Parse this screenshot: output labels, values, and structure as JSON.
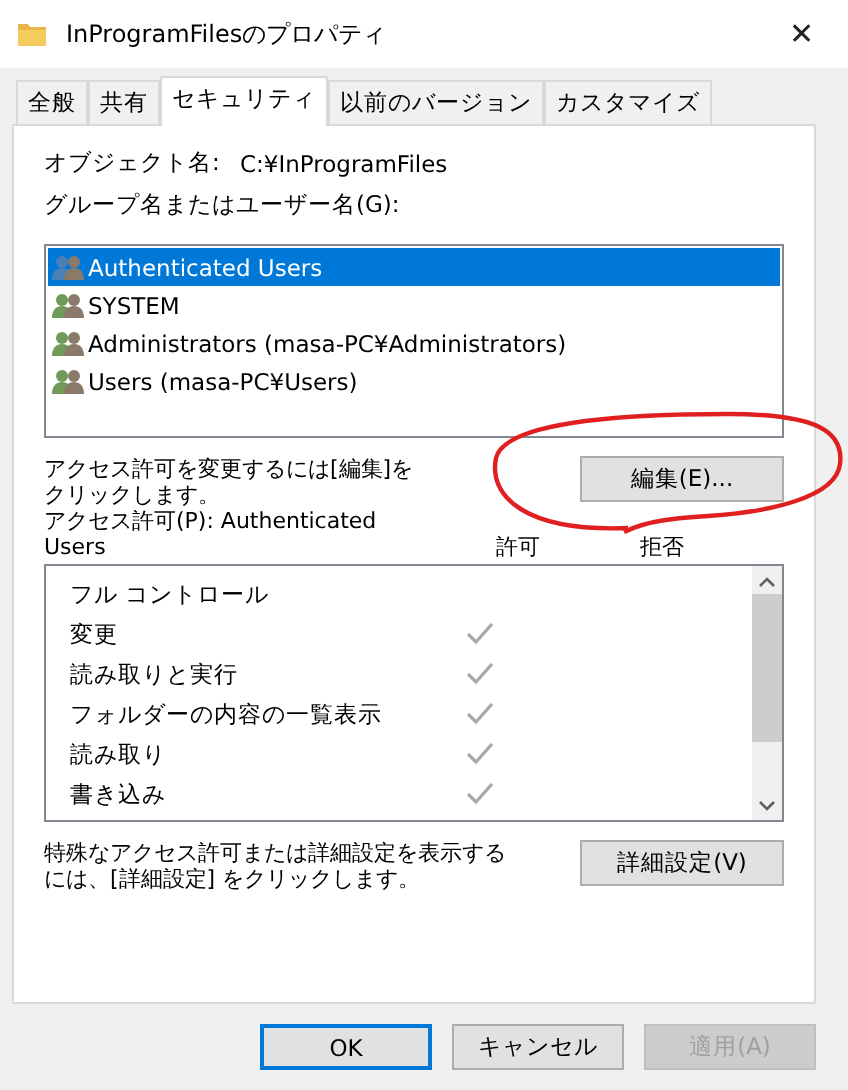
{
  "window": {
    "title": "InProgramFilesのプロパティ",
    "close": "✕"
  },
  "tabs": [
    {
      "label": "全般",
      "selected": false
    },
    {
      "label": "共有",
      "selected": false
    },
    {
      "label": "セキュリティ",
      "selected": true
    },
    {
      "label": "以前のバージョン",
      "selected": false
    },
    {
      "label": "カスタマイズ",
      "selected": false
    }
  ],
  "object_name": {
    "label": "オブジェクト名:",
    "value": "C:¥InProgramFiles"
  },
  "group_label": "グループ名またはユーザー名(G):",
  "users": [
    {
      "name": "Authenticated Users",
      "selected": true
    },
    {
      "name": "SYSTEM",
      "selected": false
    },
    {
      "name": "Administrators (masa-PC¥Administrators)",
      "selected": false
    },
    {
      "name": "Users (masa-PC¥Users)",
      "selected": false
    }
  ],
  "edit_hint": [
    "アクセス許可を変更するには[編集]を",
    "クリックします。"
  ],
  "edit_button": "編集(E)...",
  "permissions_label": [
    "アクセス許可(P): Authenticated",
    "Users"
  ],
  "columns": {
    "allow": "許可",
    "deny": "拒否"
  },
  "permissions": [
    {
      "name": "フル コントロール",
      "allow": false,
      "deny": false
    },
    {
      "name": "変更",
      "allow": true,
      "deny": false
    },
    {
      "name": "読み取りと実行",
      "allow": true,
      "deny": false
    },
    {
      "name": "フォルダーの内容の一覧表示",
      "allow": true,
      "deny": false
    },
    {
      "name": "読み取り",
      "allow": true,
      "deny": false
    },
    {
      "name": "書き込み",
      "allow": true,
      "deny": false
    }
  ],
  "advanced_hint": [
    "特殊なアクセス許可または詳細設定を表示する",
    "には、[詳細設定] をクリックします。"
  ],
  "advanced_button": "詳細設定(V)",
  "buttons": [
    {
      "label": "OK",
      "kind": "default",
      "disabled": false
    },
    {
      "label": "キャンセル",
      "kind": "normal",
      "disabled": false
    },
    {
      "label": "適用(A)",
      "kind": "normal",
      "disabled": true
    }
  ],
  "annotations": [
    {
      "kind": "freehand-circle",
      "color": "#e02020"
    }
  ]
}
